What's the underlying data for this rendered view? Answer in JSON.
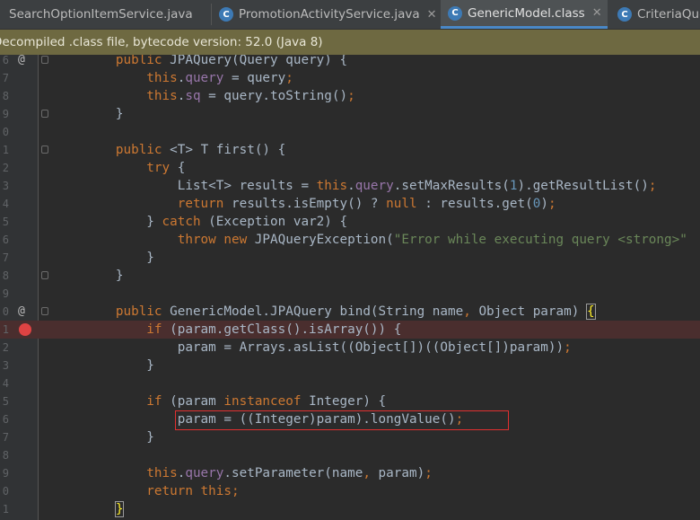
{
  "tabs": [
    {
      "label": "SearchOptionItemService.java",
      "icon": "class-c-icon",
      "active": false
    },
    {
      "label": "PromotionActivityService.java",
      "icon": "class-c-icon",
      "active": false
    },
    {
      "label": "GenericModel.class",
      "icon": "class-c-icon",
      "active": true
    },
    {
      "label": "CriteriaQue",
      "icon": "class-c-icon",
      "active": false
    }
  ],
  "banner": "Decompiled .class file, bytecode version: 52.0 (Java 8)",
  "line_numbers": [
    "6",
    "7",
    "8",
    "9",
    "0",
    "1",
    "2",
    "3",
    "4",
    "5",
    "6",
    "7",
    "8",
    "9",
    "0",
    "1",
    "2",
    "3",
    "4",
    "5",
    "6",
    "7",
    "8",
    "9",
    "0",
    "1"
  ],
  "highlight": {
    "border_color": "#e03030",
    "line": "param = ((Integer)param).longValue();"
  },
  "colors": {
    "keyword": "#cc7832",
    "string": "#6a8759",
    "number": "#6897bb",
    "field": "#9876aa",
    "text": "#a9b7c6",
    "banner_bg": "#6e6941",
    "breakpoint": "#e04343"
  }
}
